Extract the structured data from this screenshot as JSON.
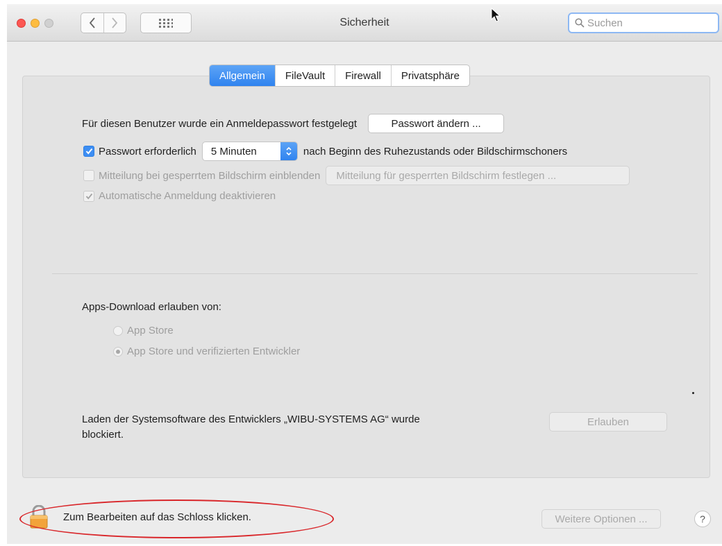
{
  "window": {
    "title": "Sicherheit"
  },
  "search": {
    "placeholder": "Suchen"
  },
  "tabs": [
    {
      "label": "Allgemein",
      "active": true
    },
    {
      "label": "FileVault",
      "active": false
    },
    {
      "label": "Firewall",
      "active": false
    },
    {
      "label": "Privatsphäre",
      "active": false
    }
  ],
  "general": {
    "password_text": "Für diesen Benutzer wurde ein Anmeldepasswort festgelegt",
    "change_password_label": "Passwort ändern ...",
    "require_password_label": "Passwort erforderlich",
    "require_password_checked": true,
    "delay_value": "5 Minuten",
    "after_text": "nach Beginn des Ruhezustands oder Bildschirmschoners",
    "lock_message_label": "Mitteilung bei gesperrtem Bildschirm einblenden",
    "lock_message_checked": false,
    "lock_message_button": "Mitteilung für gesperrten Bildschirm festlegen ...",
    "auto_login_label": "Automatische Anmeldung deaktivieren",
    "auto_login_checked": true
  },
  "downloads": {
    "heading": "Apps-Download erlauben von:",
    "options": [
      {
        "label": "App Store",
        "selected": false
      },
      {
        "label": "App Store und verifizierten Entwickler",
        "selected": true
      }
    ]
  },
  "blocked": {
    "text_line1": "Laden der Systemsoftware des Entwicklers „WIBU-SYSTEMS AG“ wurde",
    "text_line2": "blockiert.",
    "allow_label": "Erlauben"
  },
  "footer": {
    "lock_text": "Zum Bearbeiten auf das Schloss klicken.",
    "more_options_label": "Weitere Optionen ...",
    "help_label": "?"
  },
  "colors": {
    "accent": "#2f83ef",
    "annotation": "#d9272b"
  }
}
